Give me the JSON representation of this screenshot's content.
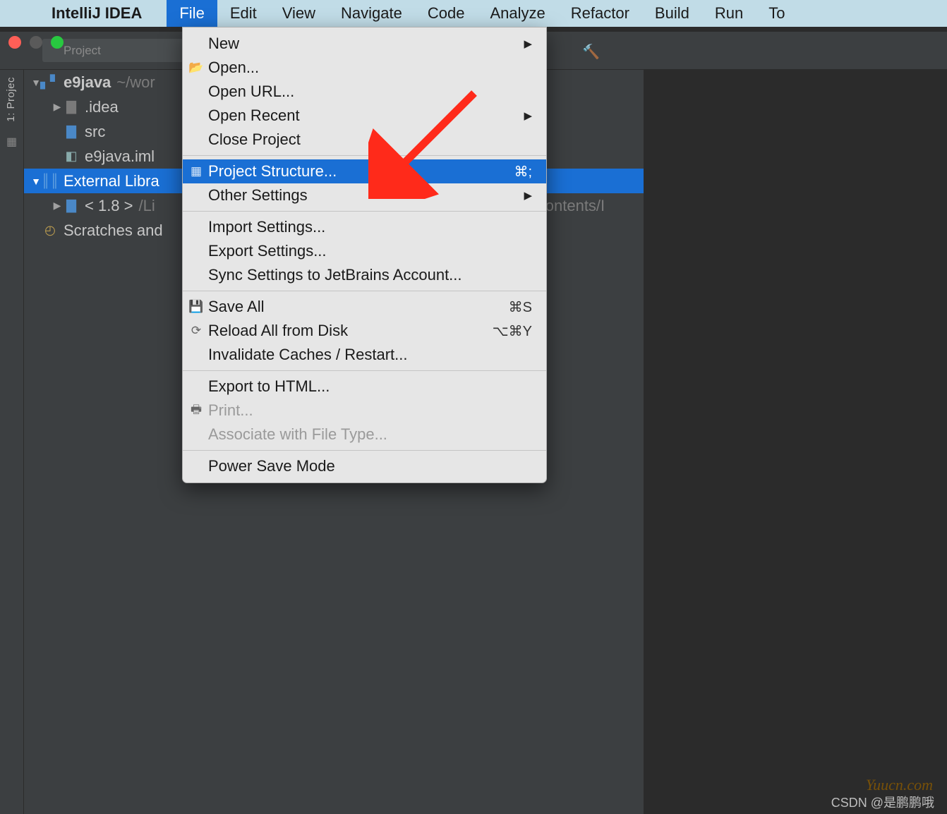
{
  "menubar": {
    "app_name": "IntelliJ IDEA",
    "items": [
      "File",
      "Edit",
      "View",
      "Navigate",
      "Code",
      "Analyze",
      "Refactor",
      "Build",
      "Run",
      "To"
    ],
    "active_index": 0
  },
  "toolbar": {
    "project_label": "Project"
  },
  "left_stripe": {
    "label": "1: Projec"
  },
  "project_tree": {
    "rows": [
      {
        "indent": 0,
        "arrow": "down",
        "icon": "folder-blue",
        "label": "e9java",
        "suffix": "~/wor",
        "selected": false
      },
      {
        "indent": 1,
        "arrow": "right",
        "icon": "folder-gray",
        "label": ".idea",
        "suffix": "",
        "selected": false
      },
      {
        "indent": 1,
        "arrow": "",
        "icon": "folder-blue",
        "label": "src",
        "suffix": "",
        "selected": false
      },
      {
        "indent": 1,
        "arrow": "",
        "icon": "file",
        "label": "e9java.iml",
        "suffix": "",
        "selected": false
      },
      {
        "indent": 0,
        "arrow": "down",
        "icon": "lib",
        "label": "External Libra",
        "suffix": "",
        "selected": true
      },
      {
        "indent": 1,
        "arrow": "right",
        "icon": "folder-blue",
        "label": "< 1.8 >",
        "suffix": "/Li",
        "selected": false
      },
      {
        "indent": 0,
        "arrow": "",
        "icon": "scratch",
        "label": "Scratches and",
        "suffix": "",
        "selected": false
      }
    ],
    "obscured_path_fragment": "k/Contents/I"
  },
  "dropdown": {
    "groups": [
      [
        {
          "label": "New",
          "submenu": true
        },
        {
          "label": "Open...",
          "icon": "open-icon"
        },
        {
          "label": "Open URL..."
        },
        {
          "label": "Open Recent",
          "submenu": true
        },
        {
          "label": "Close Project"
        }
      ],
      [
        {
          "label": "Project Structure...",
          "icon": "project-structure-icon",
          "shortcut": "⌘;",
          "highlighted": true
        },
        {
          "label": "Other Settings",
          "submenu": true
        }
      ],
      [
        {
          "label": "Import Settings..."
        },
        {
          "label": "Export Settings..."
        },
        {
          "label": "Sync Settings to JetBrains Account..."
        }
      ],
      [
        {
          "label": "Save All",
          "icon": "save-icon",
          "shortcut": "⌘S"
        },
        {
          "label": "Reload All from Disk",
          "icon": "reload-icon",
          "shortcut": "⌥⌘Y"
        },
        {
          "label": "Invalidate Caches / Restart..."
        }
      ],
      [
        {
          "label": "Export to HTML..."
        },
        {
          "label": "Print...",
          "icon": "print-icon",
          "disabled": true
        },
        {
          "label": "Associate with File Type...",
          "disabled": true
        }
      ],
      [
        {
          "label": "Power Save Mode"
        }
      ]
    ]
  },
  "watermarks": {
    "site": "Yuucn.com",
    "csdn": "CSDN @是鹏鹏哦"
  },
  "colors": {
    "menubar_bg": "#c1dce7",
    "highlight": "#1a6fd4",
    "dark_bg": "#3c3f41",
    "editor_bg": "#2b2b2b",
    "arrow_red": "#ff2a1a"
  }
}
